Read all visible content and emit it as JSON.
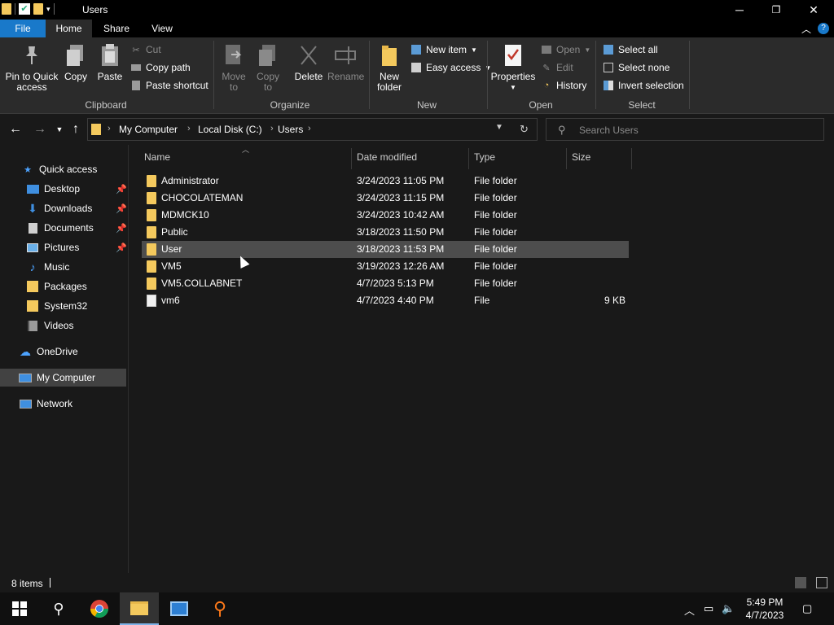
{
  "window": {
    "title": "Users",
    "controls": {
      "minimize": "─",
      "maximize": "❐",
      "close": "✕"
    }
  },
  "ribbon_tabs": [
    {
      "label": "File"
    },
    {
      "label": "Home"
    },
    {
      "label": "Share"
    },
    {
      "label": "View"
    }
  ],
  "ribbon": {
    "clipboard": {
      "label": "Clipboard",
      "pin": "Pin to Quick access",
      "pin_line1": "Pin to Quick",
      "pin_line2": "access",
      "copy": "Copy",
      "paste": "Paste",
      "cut": "Cut",
      "copy_path": "Copy path",
      "paste_shortcut": "Paste shortcut"
    },
    "organize": {
      "label": "Organize",
      "move_to_1": "Move",
      "move_to_2": "to",
      "copy_to_1": "Copy",
      "copy_to_2": "to",
      "delete": "Delete",
      "rename": "Rename"
    },
    "new": {
      "label": "New",
      "new_folder_1": "New",
      "new_folder_2": "folder",
      "new_item": "New item",
      "easy_access": "Easy access"
    },
    "open": {
      "label": "Open",
      "properties": "Properties",
      "open": "Open",
      "edit": "Edit",
      "history": "History"
    },
    "select": {
      "label": "Select",
      "select_all": "Select all",
      "select_none": "Select none",
      "invert": "Invert selection"
    }
  },
  "address": {
    "crumbs": [
      "My Computer",
      "Local Disk (C:)",
      "Users"
    ],
    "search_placeholder": "Search Users"
  },
  "nav": {
    "items": [
      {
        "label": "Quick access",
        "icon": "star-icon",
        "pinned": false
      },
      {
        "label": "Desktop",
        "icon": "desktop-icon",
        "pinned": true
      },
      {
        "label": "Downloads",
        "icon": "download-icon",
        "pinned": true
      },
      {
        "label": "Documents",
        "icon": "documents-icon",
        "pinned": true
      },
      {
        "label": "Pictures",
        "icon": "pictures-icon",
        "pinned": true
      },
      {
        "label": "Music",
        "icon": "music-icon",
        "pinned": false
      },
      {
        "label": "Packages",
        "icon": "folder-icon",
        "pinned": false
      },
      {
        "label": "System32",
        "icon": "folder-icon",
        "pinned": false
      },
      {
        "label": "Videos",
        "icon": "videos-icon",
        "pinned": false
      },
      {
        "label": "OneDrive",
        "icon": "cloud-icon",
        "pinned": false
      },
      {
        "label": "My Computer",
        "icon": "computer-icon",
        "pinned": false
      },
      {
        "label": "Network",
        "icon": "network-icon",
        "pinned": false
      }
    ]
  },
  "columns": {
    "name": "Name",
    "date": "Date modified",
    "type": "Type",
    "size": "Size"
  },
  "files": [
    {
      "name": "Administrator",
      "date": "3/24/2023 11:05 PM",
      "type": "File folder",
      "size": "",
      "kind": "folder"
    },
    {
      "name": "CHOCOLATEMAN",
      "date": "3/24/2023 11:15 PM",
      "type": "File folder",
      "size": "",
      "kind": "folder"
    },
    {
      "name": "MDMCK10",
      "date": "3/24/2023 10:42 AM",
      "type": "File folder",
      "size": "",
      "kind": "folder"
    },
    {
      "name": "Public",
      "date": "3/18/2023 11:50 PM",
      "type": "File folder",
      "size": "",
      "kind": "folder"
    },
    {
      "name": "User",
      "date": "3/18/2023 11:53 PM",
      "type": "File folder",
      "size": "",
      "kind": "folder",
      "selected": true
    },
    {
      "name": "VM5",
      "date": "3/19/2023 12:26 AM",
      "type": "File folder",
      "size": "",
      "kind": "folder"
    },
    {
      "name": "VM5.COLLABNET",
      "date": "4/7/2023 5:13 PM",
      "type": "File folder",
      "size": "",
      "kind": "folder"
    },
    {
      "name": "vm6",
      "date": "4/7/2023 4:40 PM",
      "type": "File",
      "size": "9 KB",
      "kind": "file"
    }
  ],
  "status": {
    "item_count": "8 items"
  },
  "taskbar": {
    "time": "5:49 PM",
    "date": "4/7/2023"
  },
  "colors": {
    "accent": "#1979ca",
    "folder": "#f4c95d",
    "selection": "#4d4d4d"
  }
}
